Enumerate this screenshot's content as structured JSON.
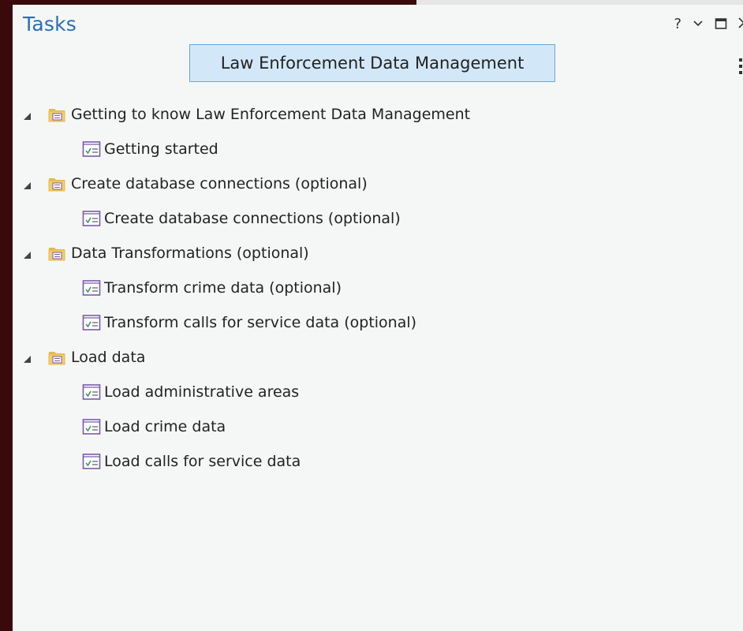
{
  "pane": {
    "title": "Tasks",
    "controls": {
      "help": "?",
      "options": "⌄",
      "maximize": "□",
      "close": "✕"
    }
  },
  "project": {
    "name": "Law Enforcement Data Management"
  },
  "tree": {
    "groups": [
      {
        "label": "Getting to know Law Enforcement Data Management",
        "tasks": [
          {
            "label": "Getting started"
          }
        ]
      },
      {
        "label": "Create database connections (optional)",
        "tasks": [
          {
            "label": "Create database connections (optional)"
          }
        ]
      },
      {
        "label": "Data Transformations (optional)",
        "tasks": [
          {
            "label": "Transform crime data (optional)"
          },
          {
            "label": "Transform calls for service data (optional)"
          }
        ]
      },
      {
        "label": "Load data",
        "tasks": [
          {
            "label": "Load administrative areas"
          },
          {
            "label": "Load crime data"
          },
          {
            "label": "Load calls for service data"
          }
        ]
      }
    ]
  },
  "colors": {
    "title": "#2a6fb3",
    "folder": "#e6b84a",
    "task_icon_border": "#7a5aa8",
    "task_icon_check": "#3a9a5a"
  },
  "icons": {
    "group": "task-group-folder-icon",
    "task": "task-checklist-icon",
    "expand": "expanded-triangle-icon"
  }
}
